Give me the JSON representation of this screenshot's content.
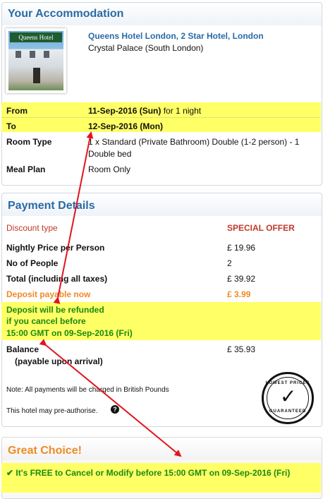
{
  "accommodation": {
    "title": "Your Accommodation",
    "hotel_name": "Queens Hotel London, 2 Star Hotel, London",
    "area": "Crystal Palace (South London)",
    "thumb_sign": "Queens Hotel",
    "rows": {
      "from_label": "From",
      "from_value": "11-Sep-2016 (Sun)",
      "from_suffix": "for 1 night",
      "to_label": "To",
      "to_value": "12-Sep-2016 (Mon)",
      "room_label": "Room Type",
      "room_value_1": "1 x Standard (Private Bathroom) Double (1-2 person) - 1",
      "room_value_2": "Double bed",
      "meal_label": "Meal Plan",
      "meal_value": "Room Only"
    }
  },
  "payment": {
    "title": "Payment Details",
    "discount_label": "Discount type",
    "discount_value": "SPECIAL OFFER",
    "nightly_label": "Nightly Price per Person",
    "nightly_value": "£ 19.96",
    "people_label": "No of People",
    "people_value": "2",
    "total_label": "Total (including all taxes)",
    "total_value": "£ 39.92",
    "deposit_label": "Deposit payable now",
    "deposit_value": "£ 3.99",
    "refund_line1": "Deposit will be refunded",
    "refund_line2": "if you cancel before",
    "refund_line3": "15:00 GMT on 09-Sep-2016 (Fri)",
    "balance_label": "Balance",
    "balance_sub": "(payable upon arrival)",
    "balance_value": "£ 35.93",
    "note": "Note: All payments will be charged in British Pounds",
    "preauth": "This hotel may pre-authorise.",
    "badge_top": "LOWEST PRICES",
    "badge_bottom": "GUARANTEED"
  },
  "great_choice": {
    "title": "Great Choice!",
    "free_text": "It's FREE to Cancel or Modify before 15:00 GMT on 09-Sep-2016 (Fri)"
  },
  "colors": {
    "highlight": "#ffff66",
    "heading_blue": "#2a6aa6",
    "arrow_red": "#e0151f",
    "green": "#1a8a0f",
    "orange": "#f08a24"
  },
  "icons": [
    "checkmark-icon",
    "help-icon",
    "lowest-price-badge-icon"
  ]
}
